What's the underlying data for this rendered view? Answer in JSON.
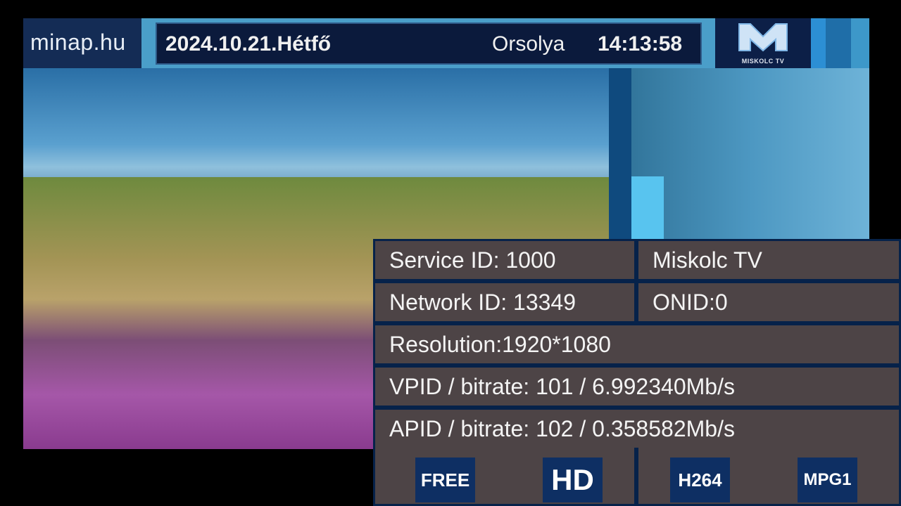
{
  "header": {
    "site_logo": "minap.hu",
    "date": "2024.10.21.Hétfő",
    "name_day": "Orsolya",
    "clock": "14:13:58",
    "channel_logo_text": "MISKOLC TV"
  },
  "info": {
    "service_id": "Service ID: 1000",
    "channel_name": "Miskolc TV",
    "network_id": "Network ID: 13349",
    "onid": "ONID:0",
    "resolution": "Resolution:1920*1080",
    "vpid_bitrate": "VPID / bitrate: 101 / 6.992340Mb/s",
    "apid_bitrate": "APID / bitrate: 102 / 0.358582Mb/s"
  },
  "badges": {
    "free": "FREE",
    "hd": "HD",
    "video_codec": "H264",
    "audio_codec": "MPG1"
  },
  "colors": {
    "osd_cell": "#4d4446",
    "osd_border": "#06224a",
    "badge_bg": "#0e2f63",
    "header_bar": "#4a9ec9"
  }
}
